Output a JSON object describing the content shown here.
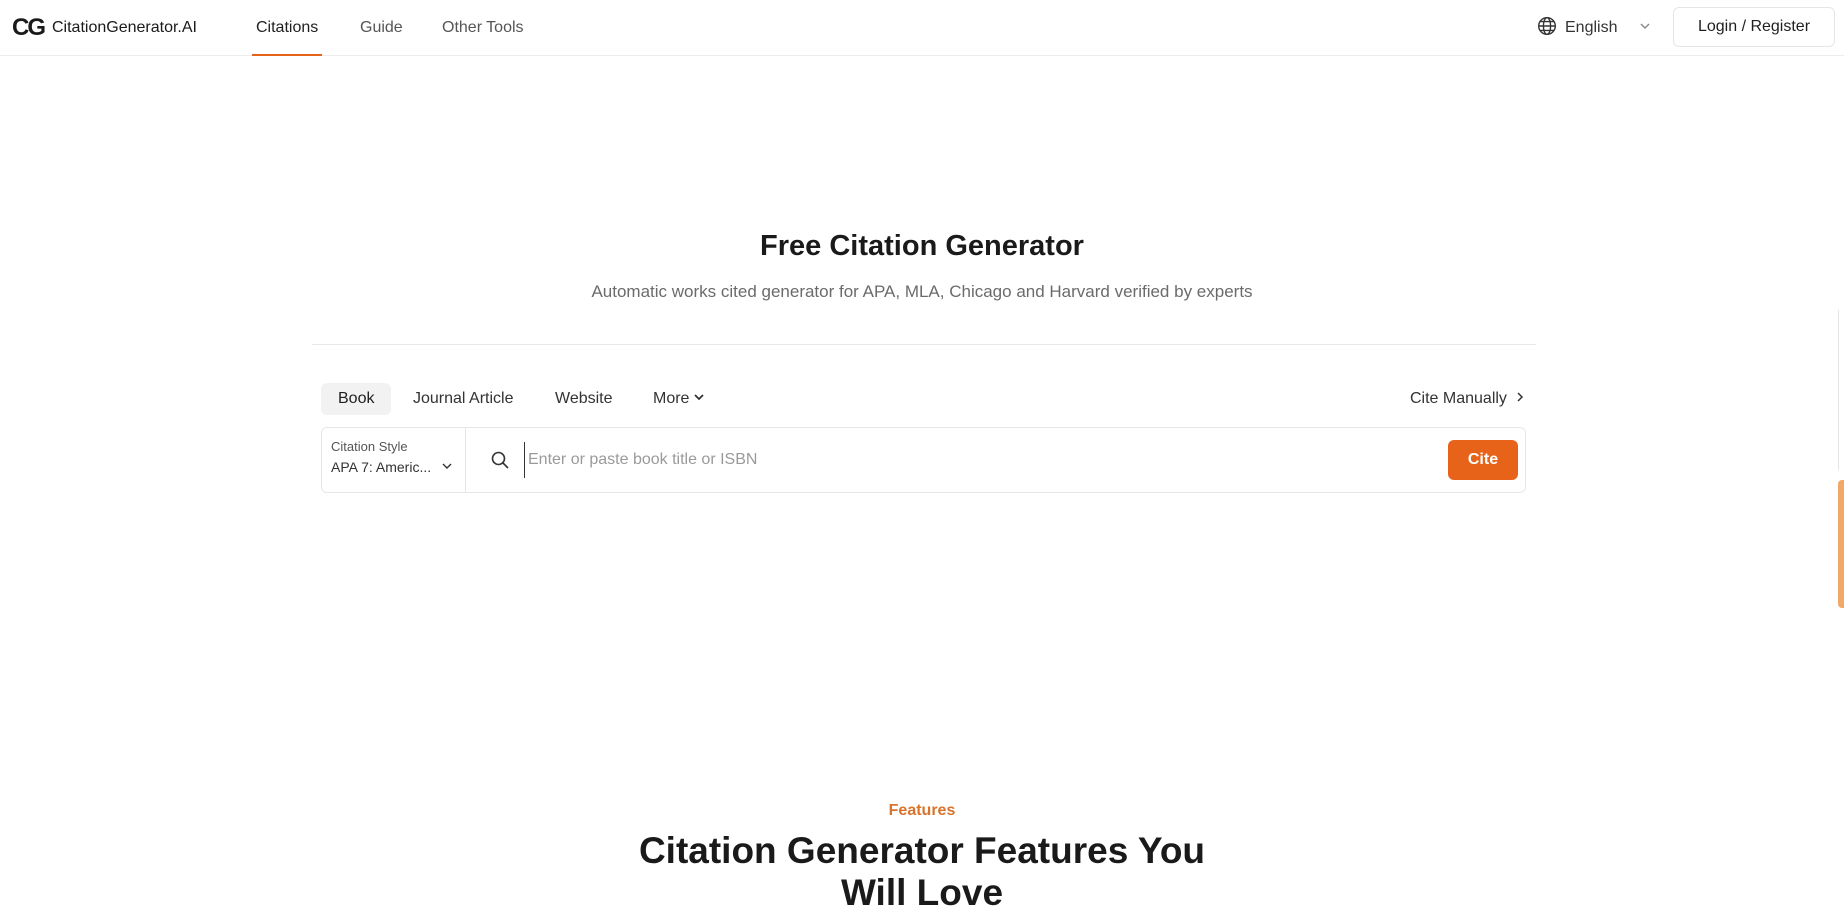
{
  "header": {
    "logo_mark": "CG",
    "logo_text": "CitationGenerator.AI",
    "nav": [
      {
        "label": "Citations",
        "active": true
      },
      {
        "label": "Guide",
        "active": false
      },
      {
        "label": "Other Tools",
        "active": false
      }
    ],
    "language": "English",
    "login_label": "Login / Register"
  },
  "hero": {
    "title": "Free Citation Generator",
    "subtitle": "Automatic works cited generator for APA, MLA, Chicago and Harvard verified by experts"
  },
  "source_tabs": [
    {
      "label": "Book",
      "active": true
    },
    {
      "label": "Journal Article",
      "active": false
    },
    {
      "label": "Website",
      "active": false
    },
    {
      "label": "More",
      "active": false
    }
  ],
  "cite_manually_label": "Cite Manually",
  "search": {
    "style_label": "Citation Style",
    "style_value": "APA 7: Americ...",
    "placeholder": "Enter or paste book title or ISBN",
    "value": "",
    "cite_label": "Cite"
  },
  "features": {
    "kicker": "Features",
    "title": "Citation Generator Features You Will Love"
  },
  "colors": {
    "accent": "#e8631a",
    "kicker": "#d9742c",
    "edge_tab": "#f0a968"
  },
  "icons": [
    "globe-icon",
    "chevron-down-icon",
    "search-icon",
    "chevron-right-icon"
  ]
}
